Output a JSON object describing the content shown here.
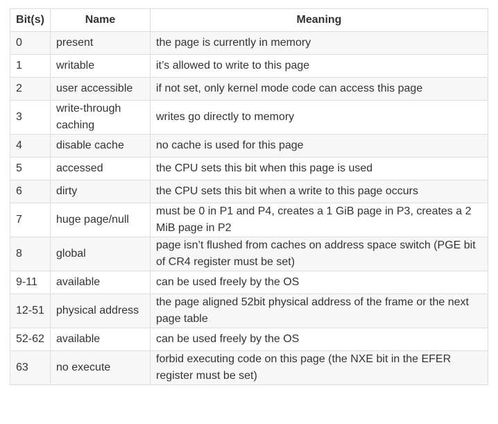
{
  "table": {
    "headers": [
      "Bit(s)",
      "Name",
      "Meaning"
    ],
    "rows": [
      {
        "bits": "0",
        "name": "present",
        "meaning": "the page is currently in memory"
      },
      {
        "bits": "1",
        "name": "writable",
        "meaning": "it’s allowed to write to this page"
      },
      {
        "bits": "2",
        "name": "user accessible",
        "meaning": "if not set, only kernel mode code can access this page"
      },
      {
        "bits": "3",
        "name": "write-through caching",
        "meaning": "writes go directly to memory"
      },
      {
        "bits": "4",
        "name": "disable cache",
        "meaning": "no cache is used for this page"
      },
      {
        "bits": "5",
        "name": "accessed",
        "meaning": "the CPU sets this bit when this page is used"
      },
      {
        "bits": "6",
        "name": "dirty",
        "meaning": "the CPU sets this bit when a write to this page occurs"
      },
      {
        "bits": "7",
        "name": "huge page/null",
        "meaning": "must be 0 in P1 and P4, creates a 1 GiB page in P3, creates a 2 MiB page in P2"
      },
      {
        "bits": "8",
        "name": "global",
        "meaning": "page isn’t flushed from caches on address space switch (PGE bit of CR4 register must be set)"
      },
      {
        "bits": "9-11",
        "name": "available",
        "meaning": "can be used freely by the OS"
      },
      {
        "bits": "12-51",
        "name": "physical address",
        "meaning": "the page aligned 52bit physical address of the frame or the next page table"
      },
      {
        "bits": "52-62",
        "name": "available",
        "meaning": "can be used freely by the OS"
      },
      {
        "bits": "63",
        "name": "no execute",
        "meaning": "forbid executing code on this page (the NXE bit in the EFER register must be set)"
      }
    ]
  }
}
